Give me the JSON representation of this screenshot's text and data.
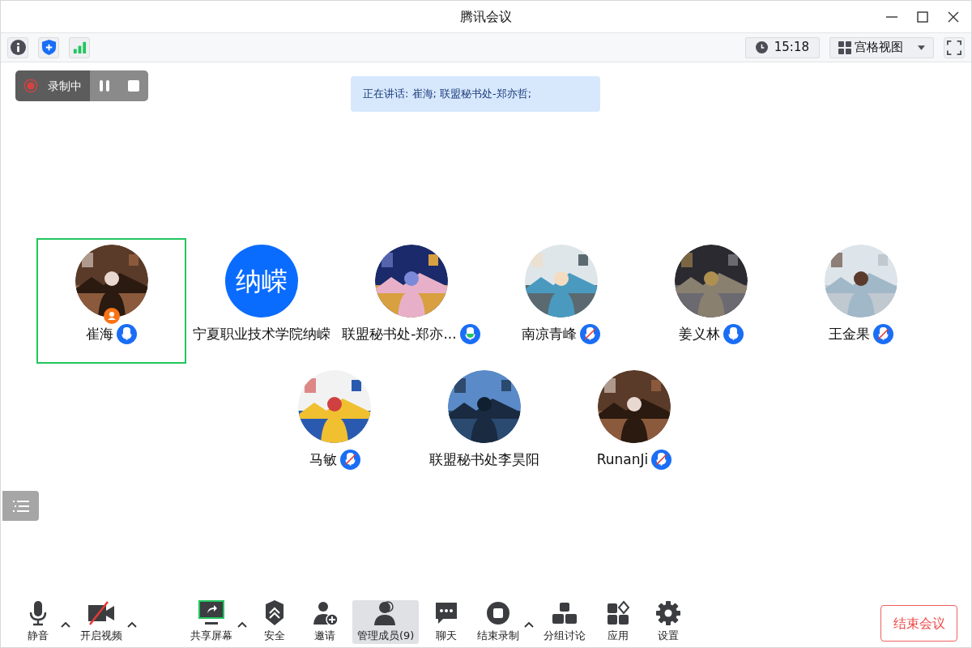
{
  "window": {
    "title": "腾讯会议"
  },
  "top_bar": {
    "time": "15:18",
    "view_label": "宫格视图"
  },
  "recording": {
    "label": "录制中"
  },
  "speaking": {
    "text": "正在讲话: 崔海; 联盟秘书处-郑亦哲;"
  },
  "participants": [
    {
      "name": "崔海",
      "kind": "picture",
      "mic": {
        "muted": false
      },
      "host": true,
      "selected": true
    },
    {
      "name": "宁夏职业技术学院纳嵘",
      "kind": "initials",
      "initials": "纳嵘",
      "host": false,
      "selected": false
    },
    {
      "name": "联盟秘书处-郑亦...",
      "kind": "picture",
      "mic": {
        "muted": false,
        "level": 0.4
      },
      "host": false,
      "selected": false
    },
    {
      "name": "南凉青峰",
      "kind": "picture",
      "mic": {
        "muted": true
      },
      "host": false,
      "selected": false
    },
    {
      "name": "姜义林",
      "kind": "picture",
      "mic": {
        "muted": false
      },
      "host": false,
      "selected": false
    },
    {
      "name": "王金果",
      "kind": "picture",
      "mic": {
        "muted": true
      },
      "host": false,
      "selected": false
    },
    {
      "name": "马敏",
      "kind": "picture",
      "mic": {
        "muted": true
      },
      "host": false,
      "selected": false
    },
    {
      "name": "联盟秘书处李昊阳",
      "kind": "picture",
      "host": false,
      "selected": false
    },
    {
      "name": "RunanJi",
      "kind": "picture",
      "mic": {
        "muted": true
      },
      "host": false,
      "selected": false
    }
  ],
  "toolbar": [
    {
      "kind": "mic",
      "label": "静音",
      "menu": true,
      "selected": false
    },
    {
      "kind": "video",
      "label": "开启视频",
      "menu": true,
      "selected": false
    },
    {
      "kind": "share",
      "label": "共享屏幕",
      "menu": true,
      "selected": false
    },
    {
      "kind": "security",
      "label": "安全",
      "menu": false,
      "selected": false
    },
    {
      "kind": "invite",
      "label": "邀请",
      "menu": false,
      "selected": false
    },
    {
      "kind": "members",
      "label": "管理成员(9)",
      "menu": false,
      "selected": true
    },
    {
      "kind": "chat",
      "label": "聊天",
      "menu": false,
      "selected": false
    },
    {
      "kind": "record",
      "label": "结束录制",
      "menu": true,
      "selected": false
    },
    {
      "kind": "breakout",
      "label": "分组讨论",
      "menu": false,
      "selected": false
    },
    {
      "kind": "apps",
      "label": "应用",
      "menu": false,
      "selected": false
    },
    {
      "kind": "settings",
      "label": "设置",
      "menu": false,
      "selected": false
    }
  ],
  "end_button": "结束会议"
}
